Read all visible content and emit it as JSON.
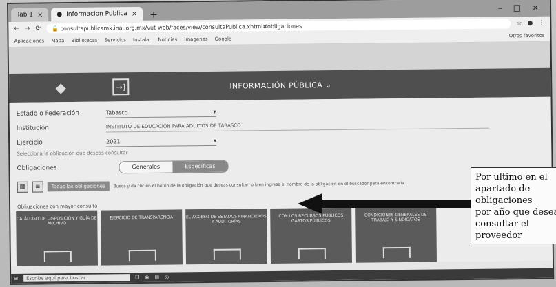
{
  "browser": {
    "tabs": [
      {
        "label": "Tab 1"
      },
      {
        "label": "Informacion Publica",
        "active": true
      }
    ],
    "url": "consultapublicamx.inai.org.mx/vut-web/faces/view/consultaPublica.xhtml#obligaciones",
    "bookmarks": [
      "Aplicaciones",
      "Mapa",
      "Bibliotecas",
      "Servicios",
      "Instalar",
      "Noticias",
      "Imagenes",
      "Google",
      "Otros favoritos"
    ]
  },
  "header": {
    "title": "INFORMACIÓN PÚBLICA"
  },
  "form": {
    "estado_label": "Estado o Federación",
    "estado_value": "Tabasco",
    "institucion_label": "Institución",
    "institucion_value": "INSTITUTO DE EDUCACIÓN PARA ADULTOS DE TABASCO",
    "ejercicio_label": "Ejercicio",
    "ejercicio_value": "2021",
    "hint": "Selecciona la obligación que deseas consultar",
    "obligaciones_label": "Obligaciones",
    "toggle_generales": "Generales",
    "toggle_especificas": "Específicas",
    "view_button": "Todas las obligaciones",
    "view_description": "Busca y da clic en el botón de la obligación que deseas consultar, o bien ingresa el nombre de la obligación en el buscador para encontrarla",
    "subtitle": "Obligaciones con mayor consulta"
  },
  "cards": [
    {
      "label": "CATÁLOGO DE DISPOSICIÓN Y GUÍA DE ARCHIVO"
    },
    {
      "label": "EJERCICIO DE TRANSPARENCIA"
    },
    {
      "label": "EL ACCESO DE ESTADOS FINANCIEROS Y AUDITORÍAS"
    },
    {
      "label": "CON LOS RECURSOS PÚBLICOS GASTOS PÚBLICOS"
    },
    {
      "label": "CONDICIONES GENERALES DE TRABAJO Y SINDICATOS"
    }
  ],
  "taskbar": {
    "search_placeholder": "Escribe aquí para buscar"
  },
  "annotation": {
    "lines": [
      "Por ultimo en el",
      "apartado de",
      "obligaciones",
      "por año que desea",
      "consultar el",
      "proveedor"
    ]
  }
}
